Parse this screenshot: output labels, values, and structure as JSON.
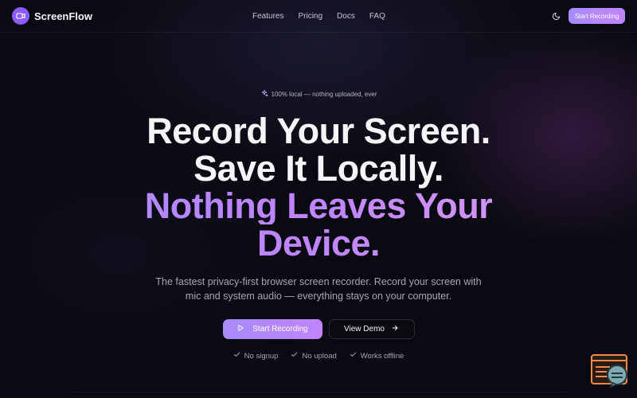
{
  "nav": {
    "brand": "ScreenFlow",
    "links": [
      "Features",
      "Pricing",
      "Docs",
      "FAQ"
    ],
    "cta_label": "Start Recording"
  },
  "hero": {
    "badge": "100% local — nothing uploaded, ever",
    "headline_lines": [
      "Record Your Screen.",
      "Save It Locally."
    ],
    "headline_highlight_lines": [
      "Nothing Leaves Your",
      "Device."
    ],
    "subtitle": "The fastest privacy-first browser screen recorder. Record your screen with mic and system audio — everything stays on your computer.",
    "primary_cta": "Start Recording",
    "secondary_cta": "View Demo",
    "checks": [
      "No signup",
      "No upload",
      "Works offline"
    ]
  },
  "colors": {
    "background": "#0a0b12",
    "accent": "#a78bfa",
    "accent_alt": "#c084fc",
    "widget": "#f08a4b"
  },
  "icons": {
    "brand": "video-camera-icon",
    "theme": "moon-icon",
    "badge": "sparkles-icon",
    "primary_cta": "play-icon",
    "secondary_cta": "arrow-right-icon",
    "checks": "check-icon",
    "widget": "chat-support-icon"
  }
}
